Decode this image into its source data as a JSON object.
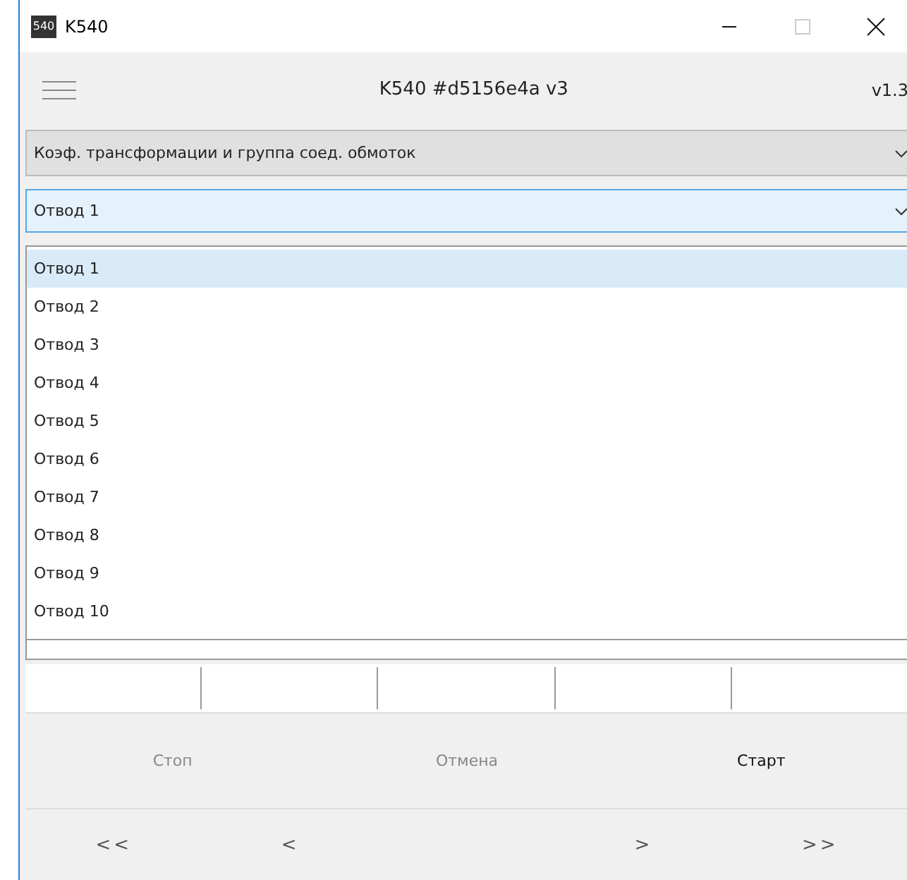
{
  "window": {
    "title": "K540",
    "icon_text": "540"
  },
  "header": {
    "title": "K540 #d5156e4a v3",
    "version": "v1.3"
  },
  "mode_select": {
    "value": "Коэф. трансформации и группа соед. обмоток"
  },
  "tap_select": {
    "value": "Отвод 1",
    "expanded": true,
    "options": [
      {
        "label": "Отвод 1",
        "selected": true
      },
      {
        "label": "Отвод 2",
        "selected": false
      },
      {
        "label": "Отвод 3",
        "selected": false
      },
      {
        "label": "Отвод 4",
        "selected": false
      },
      {
        "label": "Отвод 5",
        "selected": false
      },
      {
        "label": "Отвод 6",
        "selected": false
      },
      {
        "label": "Отвод 7",
        "selected": false
      },
      {
        "label": "Отвод 8",
        "selected": false
      },
      {
        "label": "Отвод 9",
        "selected": false
      },
      {
        "label": "Отвод 10",
        "selected": false
      }
    ]
  },
  "actions": [
    {
      "label": "Стоп",
      "disabled": true
    },
    {
      "label": "Отмена",
      "disabled": true
    },
    {
      "label": "Старт",
      "disabled": false
    }
  ],
  "navigation": [
    {
      "label": "<<"
    },
    {
      "label": "<"
    },
    {
      "label": ">"
    },
    {
      "label": ">>"
    }
  ]
}
